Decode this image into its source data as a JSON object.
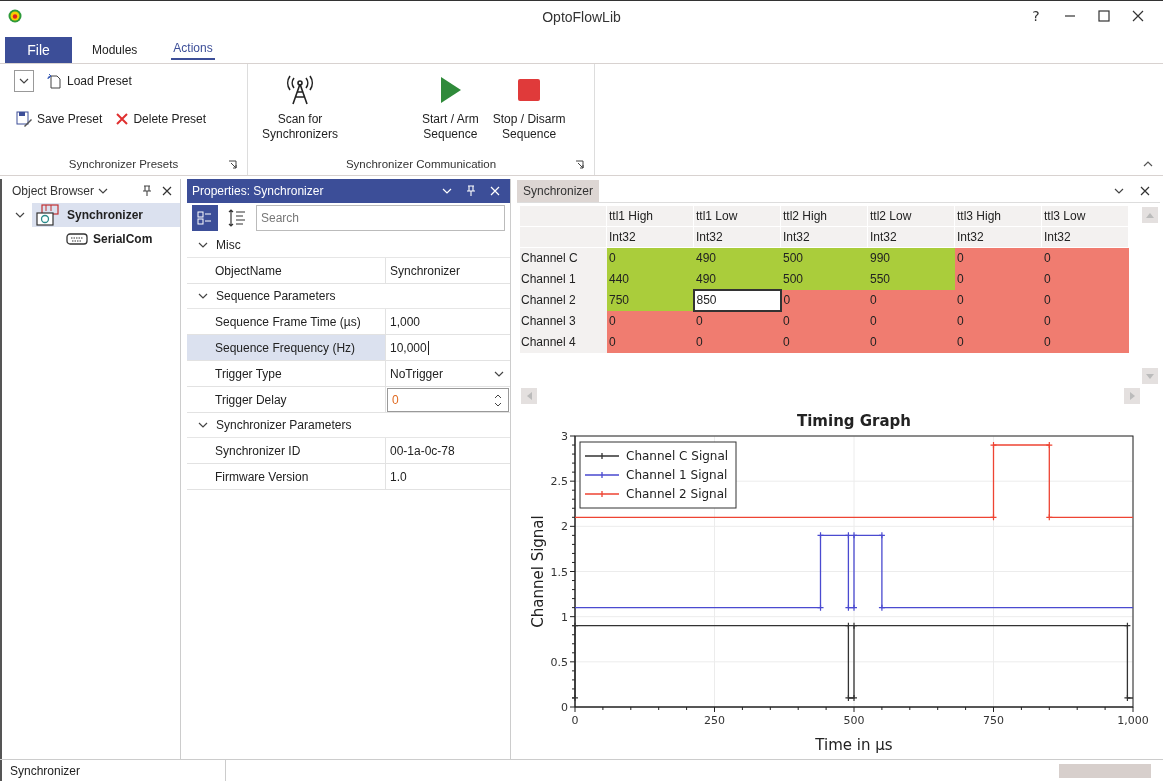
{
  "window": {
    "title": "OptoFlowLib",
    "help": "?"
  },
  "ribbon": {
    "tabs": [
      {
        "label": "File",
        "kind": "file",
        "selected": false
      },
      {
        "label": "Modules",
        "kind": "tab",
        "selected": false
      },
      {
        "label": "Actions",
        "kind": "tab",
        "selected": true
      }
    ],
    "groups": [
      {
        "label": "Synchronizer Presets",
        "buttons": [
          {
            "label": "Load Preset"
          },
          {
            "label": "Save Preset"
          },
          {
            "label": "Delete Preset"
          }
        ]
      },
      {
        "label": "Synchronizer Communication",
        "buttons": [
          {
            "label": "Scan for\nSynchronizers"
          },
          {
            "label": "Start / Arm\nSequence"
          },
          {
            "label": "Stop / Disarm\nSequence"
          }
        ]
      }
    ]
  },
  "object_browser": {
    "title": "Object Browser",
    "tree": [
      {
        "label": "Synchronizer",
        "expanded": true,
        "selected": true,
        "children": [
          {
            "label": "SerialCom",
            "selected": false
          }
        ]
      }
    ]
  },
  "properties": {
    "title": "Properties: Synchronizer",
    "view_modes": [
      {
        "selected": true
      },
      {
        "selected": false
      }
    ],
    "search": {
      "placeholder": "Search"
    },
    "categories": [
      {
        "label": "Misc",
        "expanded": true,
        "rows": [
          {
            "name": "ObjectName",
            "value": "Synchronizer",
            "kind": "text",
            "selected": false
          }
        ]
      },
      {
        "label": "Sequence Parameters",
        "expanded": true,
        "rows": [
          {
            "name": "Sequence Frame Time (µs)",
            "value": "1,000",
            "kind": "text",
            "selected": false
          },
          {
            "name": "Sequence Frequency (Hz)",
            "value": "10,000",
            "kind": "text",
            "selected": true
          },
          {
            "name": "Trigger Type",
            "value": "NoTrigger",
            "kind": "dropdown",
            "selected": false
          },
          {
            "name": "Trigger Delay",
            "value": "0",
            "kind": "spinner",
            "selected": false
          }
        ]
      },
      {
        "label": "Synchronizer Parameters",
        "expanded": true,
        "rows": [
          {
            "name": "Synchronizer ID",
            "value": "00-1a-0c-78",
            "kind": "text",
            "selected": false
          },
          {
            "name": "Firmware Version",
            "value": "1.0",
            "kind": "text",
            "selected": false
          }
        ]
      }
    ]
  },
  "document": {
    "tab": "Synchronizer",
    "grid": {
      "columns": [
        {
          "name": "ttl1 High",
          "type": "Int32"
        },
        {
          "name": "ttl1 Low",
          "type": "Int32"
        },
        {
          "name": "ttl2 High",
          "type": "Int32"
        },
        {
          "name": "ttl2 Low",
          "type": "Int32"
        },
        {
          "name": "ttl3 High",
          "type": "Int32"
        },
        {
          "name": "ttl3 Low",
          "type": "Int32"
        }
      ],
      "rows": [
        {
          "label": "Channel C",
          "cells": [
            {
              "value": "0",
              "color": "#aacd3b",
              "selected": false
            },
            {
              "value": "490",
              "color": "#aacd3b",
              "selected": false
            },
            {
              "value": "500",
              "color": "#aacd3b",
              "selected": false
            },
            {
              "value": "990",
              "color": "#aacd3b",
              "selected": false
            },
            {
              "value": "0",
              "color": "#f07c70",
              "selected": false
            },
            {
              "value": "0",
              "color": "#f07c70",
              "selected": false
            }
          ]
        },
        {
          "label": "Channel 1",
          "cells": [
            {
              "value": "440",
              "color": "#aacd3b",
              "selected": false
            },
            {
              "value": "490",
              "color": "#aacd3b",
              "selected": false
            },
            {
              "value": "500",
              "color": "#aacd3b",
              "selected": false
            },
            {
              "value": "550",
              "color": "#aacd3b",
              "selected": false
            },
            {
              "value": "0",
              "color": "#f07c70",
              "selected": false
            },
            {
              "value": "0",
              "color": "#f07c70",
              "selected": false
            }
          ]
        },
        {
          "label": "Channel 2",
          "cells": [
            {
              "value": "750",
              "color": "#aacd3b",
              "selected": false
            },
            {
              "value": "850",
              "selected": true
            },
            {
              "value": "0",
              "color": "#f07c70",
              "selected": false
            },
            {
              "value": "0",
              "color": "#f07c70",
              "selected": false
            },
            {
              "value": "0",
              "color": "#f07c70",
              "selected": false
            },
            {
              "value": "0",
              "color": "#f07c70",
              "selected": false
            }
          ]
        },
        {
          "label": "Channel 3",
          "cells": [
            {
              "value": "0",
              "color": "#f07c70",
              "selected": false
            },
            {
              "value": "0",
              "color": "#f07c70",
              "selected": false
            },
            {
              "value": "0",
              "color": "#f07c70",
              "selected": false
            },
            {
              "value": "0",
              "color": "#f07c70",
              "selected": false
            },
            {
              "value": "0",
              "color": "#f07c70",
              "selected": false
            },
            {
              "value": "0",
              "color": "#f07c70",
              "selected": false
            }
          ]
        },
        {
          "label": "Channel 4",
          "cells": [
            {
              "value": "0",
              "color": "#f07c70",
              "selected": false
            },
            {
              "value": "0",
              "color": "#f07c70",
              "selected": false
            },
            {
              "value": "0",
              "color": "#f07c70",
              "selected": false
            },
            {
              "value": "0",
              "color": "#f07c70",
              "selected": false
            },
            {
              "value": "0",
              "color": "#f07c70",
              "selected": false
            },
            {
              "value": "0",
              "color": "#f07c70",
              "selected": false
            }
          ]
        }
      ]
    },
    "chart_data": {
      "type": "line",
      "title": "Timing Graph",
      "xlabel": "Time in µs",
      "ylabel": "Channel Signal",
      "x": [
        0,
        0,
        440,
        440,
        490,
        490,
        500,
        500,
        550,
        550,
        750,
        750,
        850,
        850,
        990,
        990,
        1000
      ],
      "series": [
        {
          "name": "Channel C Signal",
          "color": "#333333",
          "values": [
            0.1,
            0.9,
            0.9,
            0.9,
            0.9,
            0.1,
            0.1,
            0.9,
            0.9,
            0.9,
            0.9,
            0.9,
            0.9,
            0.9,
            0.9,
            0.1,
            0.1
          ]
        },
        {
          "name": "Channel 1 Signal",
          "color": "#4a4ad0",
          "values": [
            1.1,
            1.1,
            1.1,
            1.9,
            1.9,
            1.1,
            1.1,
            1.9,
            1.9,
            1.1,
            1.1,
            1.1,
            1.1,
            1.1,
            1.1,
            1.1,
            1.1
          ]
        },
        {
          "name": "Channel 2 Signal",
          "color": "#ee4433",
          "values": [
            2.1,
            2.1,
            2.1,
            2.1,
            2.1,
            2.1,
            2.1,
            2.1,
            2.1,
            2.1,
            2.1,
            2.9,
            2.9,
            2.1,
            2.1,
            2.1,
            2.1
          ]
        }
      ],
      "xlim": [
        0,
        1000
      ],
      "ylim": [
        0,
        3
      ],
      "xticks": [
        {
          "value": 0,
          "label": "0"
        },
        {
          "value": 250,
          "label": "250"
        },
        {
          "value": 500,
          "label": "500"
        },
        {
          "value": 750,
          "label": "750"
        },
        {
          "value": 1000,
          "label": "1,000"
        }
      ],
      "yticks": [
        {
          "value": 0,
          "label": "0"
        },
        {
          "value": 0.5,
          "label": "0.5"
        },
        {
          "value": 1,
          "label": "1"
        },
        {
          "value": 1.5,
          "label": "1.5"
        },
        {
          "value": 2,
          "label": "2"
        },
        {
          "value": 2.5,
          "label": "2.5"
        },
        {
          "value": 3,
          "label": "3"
        }
      ],
      "grid": true,
      "legend": true
    }
  },
  "status_bar": {
    "text": "Synchronizer"
  }
}
